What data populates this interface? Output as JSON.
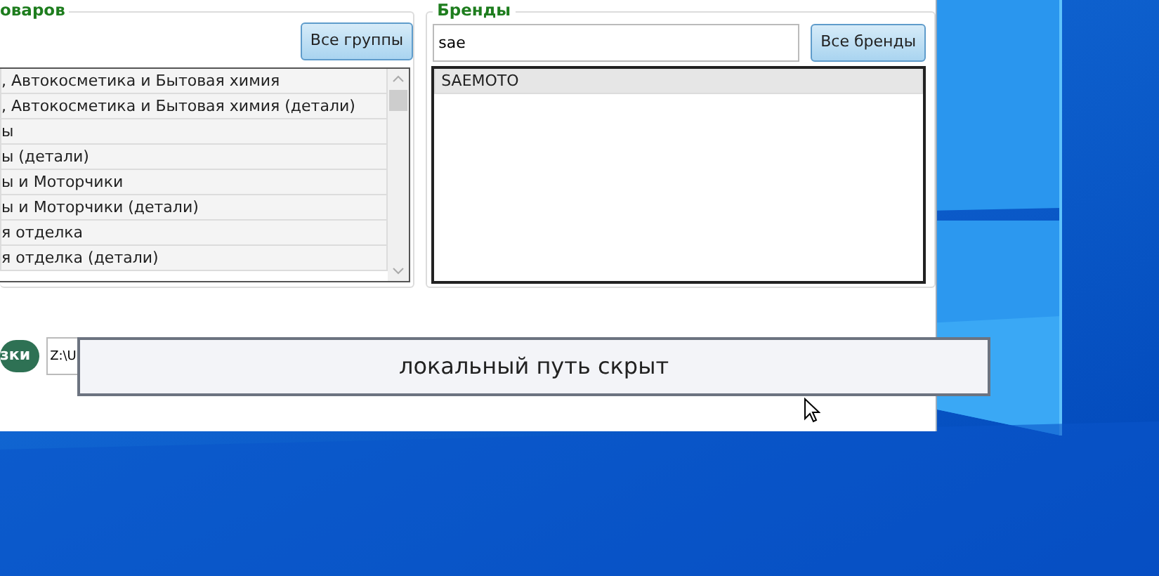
{
  "groups_panel": {
    "legend": "оваров",
    "all_button": "Все группы",
    "items": [
      {
        "label": ", Автокосметика и Бытовая химия",
        "selected": false
      },
      {
        "label": ", Автокосметика и Бытовая химия (детали)",
        "selected": false
      },
      {
        "label": "ы",
        "selected": false
      },
      {
        "label": "ы (детали)",
        "selected": false
      },
      {
        "label": "ы и Моторчики",
        "selected": false
      },
      {
        "label": "ы и Моторчики (детали)",
        "selected": false
      },
      {
        "label": "я отделка",
        "selected": false
      },
      {
        "label": "я отделка (детали)",
        "selected": false
      }
    ]
  },
  "brands_panel": {
    "legend": "Бренды",
    "search": {
      "value": "sae"
    },
    "all_button": "Все бренды",
    "items": [
      {
        "label": "SAEMOTO",
        "selected": true
      }
    ]
  },
  "footer": {
    "button": "зки",
    "path_field": {
      "value": "Z:\\U"
    }
  },
  "overlay": {
    "text": "локальный путь скрыт"
  }
}
